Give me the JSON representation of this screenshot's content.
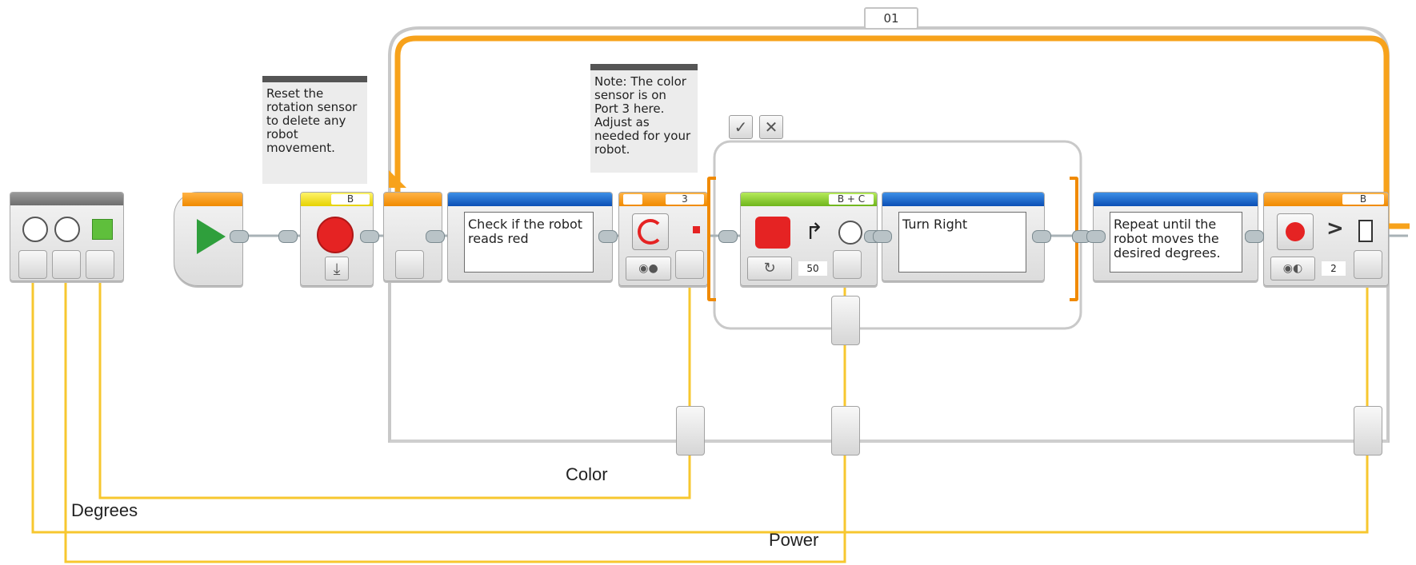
{
  "loop": {
    "name": "01"
  },
  "notes": {
    "reset": "Reset the rotation sensor to delete any robot movement.",
    "color_sensor": "Note: The color sensor is on Port 3 here. Adjust as needed for your robot."
  },
  "blocks": {
    "reset_rotation": {
      "port": "B"
    },
    "check_comment": {
      "text": "Check if the robot reads red"
    },
    "color_switch": {
      "port": "3"
    },
    "move_steering": {
      "port": "B + C",
      "power": "50"
    },
    "turn_comment": {
      "text": "Turn Right"
    },
    "repeat_comment": {
      "text": "Repeat until the robot moves the desired degrees."
    },
    "compare_rotation": {
      "port": "B",
      "operator": ">",
      "compare_type": "2"
    }
  },
  "wires": {
    "color": "Color",
    "degrees": "Degrees",
    "power": "Power"
  },
  "colors": {
    "wire": "#f7c72f",
    "loop": "#f7a21b",
    "blue": "#1160c8",
    "red": "#e52323",
    "green_start": "#2f9f3c"
  },
  "icons": [
    "play-icon",
    "rotation-sensor-icon",
    "reset-icon",
    "color-sensor-icon",
    "move-steering-icon",
    "gauge-icon",
    "check-icon",
    "close-icon",
    "compare-icon",
    "turn-arrow-icon"
  ]
}
